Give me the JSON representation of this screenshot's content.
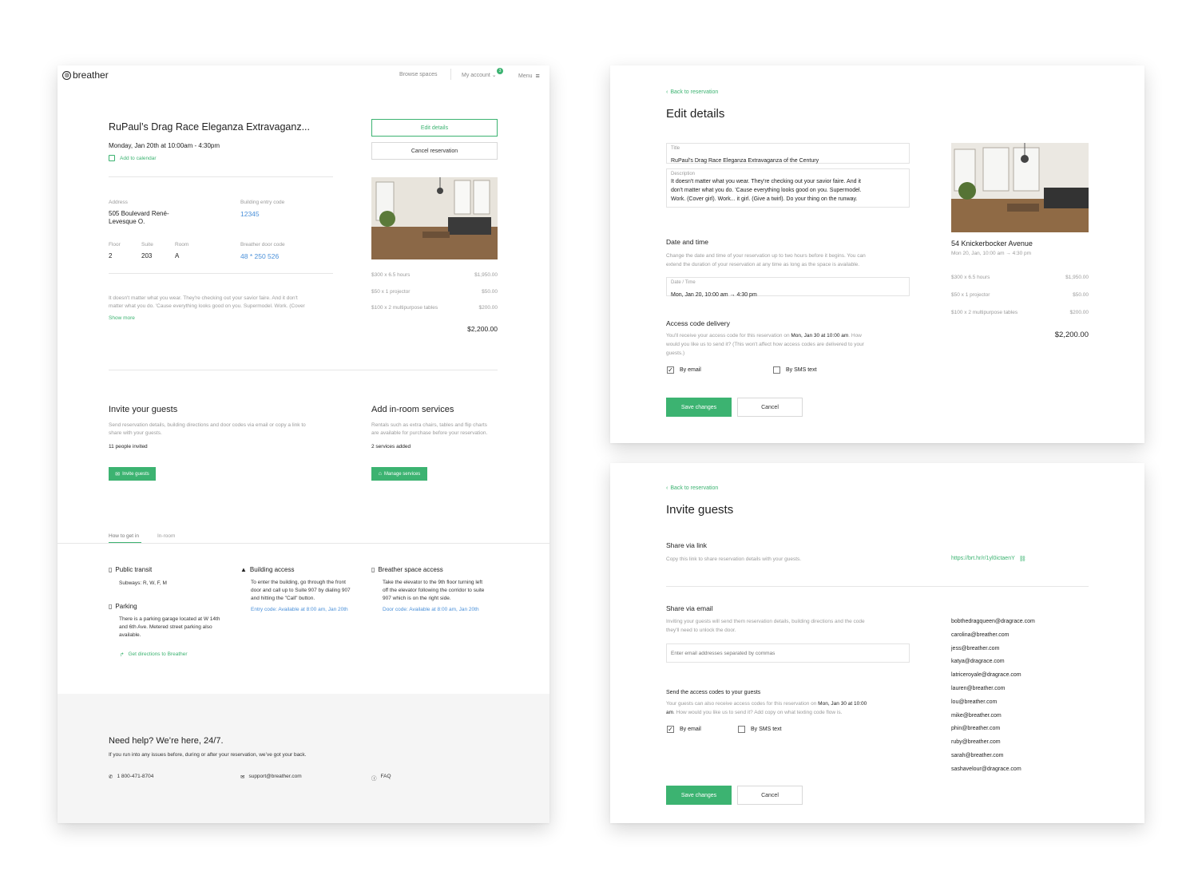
{
  "reservation": {
    "header": {
      "logo": "breather",
      "browse": "Browse spaces",
      "account": "My account",
      "account_badge": "3",
      "menu": "Menu"
    },
    "title": "RuPaul’s Drag Race Eleganza Extravaganz...",
    "datetime": "Monday, Jan 20th at 10:00am - 4:30pm",
    "add_to_calendar": "Add to calendar",
    "edit_details": "Edit details",
    "cancel_reservation": "Cancel reservation",
    "address_label": "Address",
    "address_line1": "505 Boulevard René-",
    "address_line2": "Levesque O.",
    "entry_code_label": "Building entry code",
    "entry_code": "12345",
    "floor_label": "Floor",
    "floor": "2",
    "suite_label": "Suite",
    "suite": "203",
    "room_label": "Room",
    "room": "A",
    "door_code_label": "Breather door code",
    "door_code": "48 * 250 526",
    "description_line1": "It doesn't matter what you wear. They're checking out your savior faire. And it don't",
    "description_line2": "matter what you do. 'Cause everything looks good on you. Supermodel. Work. (Cover",
    "show_more": "Show more",
    "prices": [
      {
        "label": "$300 x  6.5 hours",
        "amount": "$1,950.00"
      },
      {
        "label": "$50 x 1 projector",
        "amount": "$50.00"
      },
      {
        "label": "$100 x 2 multipurpose tables",
        "amount": "$200.00"
      }
    ],
    "total": "$2,200.00",
    "invite_title": "Invite your guests",
    "invite_desc_line1": "Send reservation details, building directions and door codes via email or copy a link to",
    "invite_desc_line2": "share with your guests.",
    "invite_count": "11 people invited",
    "invite_button": "Invite guests",
    "services_title": "Add in-room services",
    "services_desc_line1": "Rentals such as extra chairs, tables and flip charts",
    "services_desc_line2": "are available for purchase before your reservation.",
    "services_count": "2 services added",
    "services_button": "Manage services",
    "tabs": [
      "How to get in",
      "In-room"
    ],
    "transit_title": "Public transit",
    "transit_text": "Subways: R, W, F, M",
    "parking_title": "Parking",
    "parking_line1": "There is a parking garage located at W 14th",
    "parking_line2": "and 6th Ave. Metered street parking also",
    "parking_line3": "available.",
    "directions": "Get directions to Breather",
    "building_title": "Building access",
    "building_line1": "To enter the building, go through the front",
    "building_line2": "door and call up to Suite 907 by dialing 907",
    "building_line3": "and hitting the \"Call\" button.",
    "building_code": "Entry code: Available at 8:00 am, Jan 20th",
    "space_title": "Breather space access",
    "space_line1": "Take the elevator to the 9th floor turning left",
    "space_line2": "off the elevator following the corridor to suite",
    "space_line3": "907 which is on the right side.",
    "space_code": "Door code: Available at 8:00 am, Jan 20th",
    "help_title": "Need help? We’re here, 24/7.",
    "help_text": "If you run into any issues before, during or after your reservation, we’ve got your back.",
    "phone": "1 800-471-8704",
    "email": "support@breather.com",
    "faq": "FAQ"
  },
  "edit": {
    "back": "Back to reservation",
    "heading": "Edit details",
    "title_label": "Title",
    "title_value": "RuPaul’s Drag Race Eleganza Extravaganza of the Century",
    "desc_label": "Description",
    "desc_line1": "It doesn't matter what you wear. They're checking out your savior faire. And it",
    "desc_line2": "don't matter what you do. 'Cause everything looks good on you. Supermodel.",
    "desc_line3": "Work. (Cover girl). Work... it girl. (Give a twirl). Do your thing on the runway.",
    "date_heading": "Date and time",
    "date_desc_line1": "Change the date and time of your reservation up to two hours before it begins. You can",
    "date_desc_line2": "extend the duration of your reservation at any time as long as the space is available.",
    "datetime_label": "Date / Time",
    "datetime_value": "Mon, Jan 20, 10:00 am → 4:30 pm",
    "access_heading": "Access code delivery",
    "access_pre": "You'll receive your access code for this reservation on ",
    "access_bold": "Mon, Jan 30 at 10:00 am",
    "access_post": ". How",
    "access_line2": "would you like us to send it? (This won't affect how access codes are delivered to your",
    "access_line3": "guests.)",
    "by_email": "By email",
    "by_sms": "By SMS text",
    "save": "Save changes",
    "cancel": "Cancel",
    "space_name": "54 Knickerbocker Avenue",
    "space_time": "Mon 20, Jan, 10:00 am → 4:30 pm",
    "prices": [
      {
        "label": "$300 x 6.5 hours",
        "amount": "$1,950.00"
      },
      {
        "label": "$50 x 1 projector",
        "amount": "$50.00"
      },
      {
        "label": "$100 x 2 multipurpose tables",
        "amount": "$200.00"
      }
    ],
    "total": "$2,200.00"
  },
  "invite": {
    "back": "Back to reservation",
    "heading": "Invite guests",
    "link_heading": "Share via link",
    "link_desc": "Copy this link to share reservation details with your guests.",
    "link": "https://brt.hr/r/1yl0ictaenY",
    "email_heading": "Share via email",
    "email_desc_line1": "Inviting your guests will send them reservation details, building directions and the code",
    "email_desc_line2": "they'll need to unlock the door.",
    "email_placeholder": "Enter email addresses separated by commas",
    "codes_heading": "Send the access codes to your guests",
    "codes_pre": "Your guests can also receive access codes for this reservation on ",
    "codes_bold1": "Mon, Jan 30 at 10:00",
    "codes_bold2": "am",
    "codes_post": ". How would you like us to send it? Add copy on what texting code flow is.",
    "by_email": "By email",
    "by_sms": "By SMS text",
    "save": "Save changes",
    "cancel": "Cancel",
    "emails": [
      "bobthedragqueen@dragrace.com",
      "carolina@breather.com",
      "jess@breather.com",
      "katya@dragrace.com",
      "latriceroyale@dragrace.com",
      "lauren@breather.com",
      "lou@breather.com",
      "mike@breather.com",
      "phin@breather.com",
      "ruby@breather.com",
      "sarah@breather.com",
      "sashavelour@dragrace.com"
    ]
  },
  "colors": {
    "accent": "#3cb371",
    "link": "#4a90d9",
    "footer_bg": "#f5f5f5"
  }
}
